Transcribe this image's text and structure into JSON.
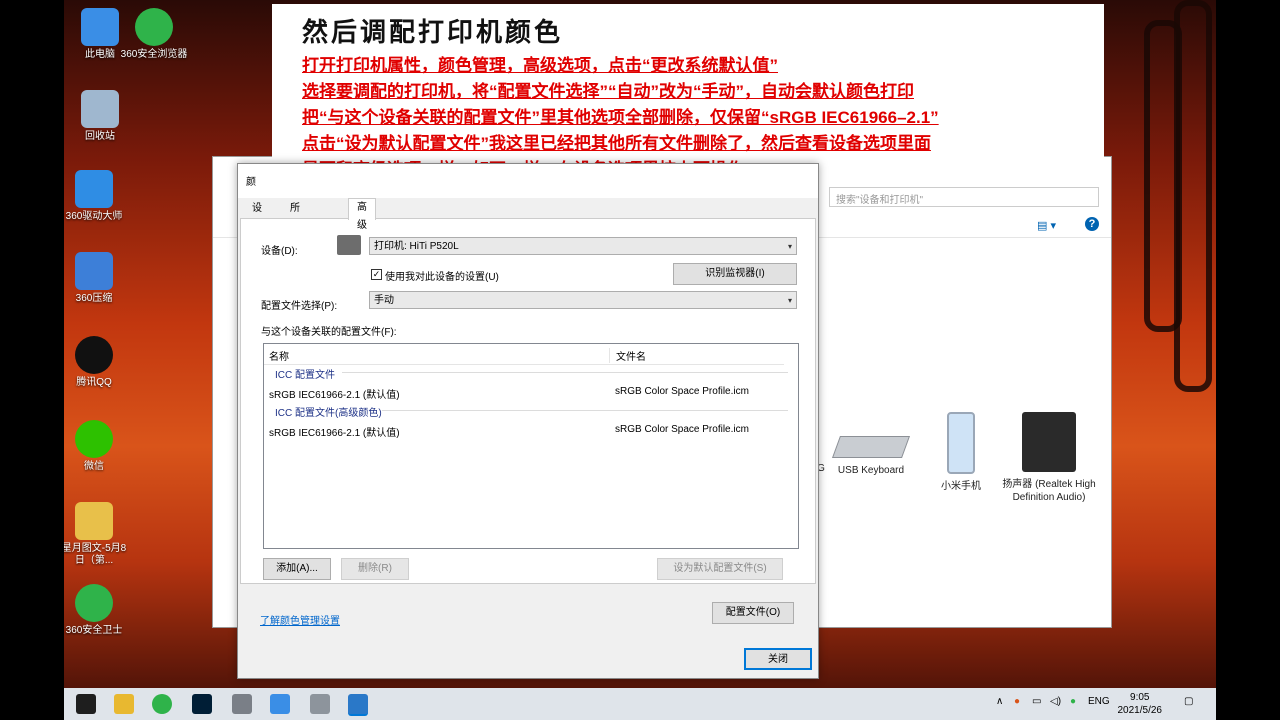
{
  "desktop": {
    "icons": [
      {
        "label": "此电脑",
        "icon": "computer-icon",
        "color": "#3a8ee6"
      },
      {
        "label": "360安全浏览器",
        "icon": "browser-icon",
        "color": "#2fb34a"
      },
      {
        "label": "回收站",
        "icon": "recycle-bin-icon",
        "color": "#9fb7cf"
      },
      {
        "label": "360驱动大师",
        "icon": "driver-icon",
        "color": "#2f8de4"
      },
      {
        "label": "360压缩",
        "icon": "zip-icon",
        "color": "#3d7fd8"
      },
      {
        "label": "腾讯QQ",
        "icon": "qq-icon",
        "color": "#111111"
      },
      {
        "label": "微信",
        "icon": "wechat-icon",
        "color": "#2dc100"
      },
      {
        "label": "星月图文-5月8日（第...",
        "icon": "folder-icon",
        "color": "#e8c04a"
      },
      {
        "label": "360安全卫士",
        "icon": "security-icon",
        "color": "#2fb34a"
      }
    ]
  },
  "banner": {
    "title": "然后调配打印机颜色",
    "lines": [
      "打开打印机属性，颜色管理，高级选项，点击“更改系统默认值”",
      "选择要调配的打印机，将“配置文件选择”“自动”改为“手动”，自动会默认颜色打印",
      "把“与这个设备关联的配置文件”里其他选项全部删除，仅保留“sRGB IEC61966–2.1”",
      "点击“设为默认配置文件”我这里已经把其他所有文件删除了，然后查看设备选项里面",
      "是否和高级选项一样，如不一样，在设备选项里按上面操作。"
    ]
  },
  "explorer": {
    "search_placeholder": "搜索\"设备和打印机\"",
    "devices": [
      {
        "label": "G",
        "icon": "device-icon"
      },
      {
        "label": "USB Keyboard",
        "icon": "keyboard-icon"
      },
      {
        "label": "小米手机",
        "icon": "phone-icon"
      },
      {
        "label": "扬声器 (Realtek High Definition Audio)",
        "icon": "speaker-icon"
      }
    ]
  },
  "dialog": {
    "title_fragment": "颜",
    "tabs": [
      "设备",
      "所有配置文件",
      "高级"
    ],
    "active_tab": "高级",
    "device_label": "设备(D):",
    "device_value": "打印机: HiTi P520L",
    "use_settings_label": "使用我对此设备的设置(U)",
    "use_settings_checked": true,
    "identify_button": "识别监视器(I)",
    "profile_select_label": "配置文件选择(P):",
    "profile_select_value": "手动",
    "associated_label": "与这个设备关联的配置文件(F):",
    "columns": [
      "名称",
      "文件名"
    ],
    "groups": [
      {
        "title": "ICC 配置文件",
        "rows": [
          {
            "name": "sRGB IEC61966-2.1 (默认值)",
            "file": "sRGB Color Space Profile.icm"
          }
        ]
      },
      {
        "title": "ICC 配置文件(高级颜色)",
        "rows": [
          {
            "name": "sRGB IEC61966-2.1 (默认值)",
            "file": "sRGB Color Space Profile.icm"
          }
        ]
      }
    ],
    "add_button": "添加(A)...",
    "remove_button": "删除(R)",
    "set_default_button": "设为默认配置文件(S)",
    "learn_link": "了解颜色管理设置",
    "profiles_button": "配置文件(O)",
    "close_button": "关闭"
  },
  "taskbar": {
    "tray_lang": "ENG",
    "time": "9:05",
    "date": "2021/5/26"
  }
}
